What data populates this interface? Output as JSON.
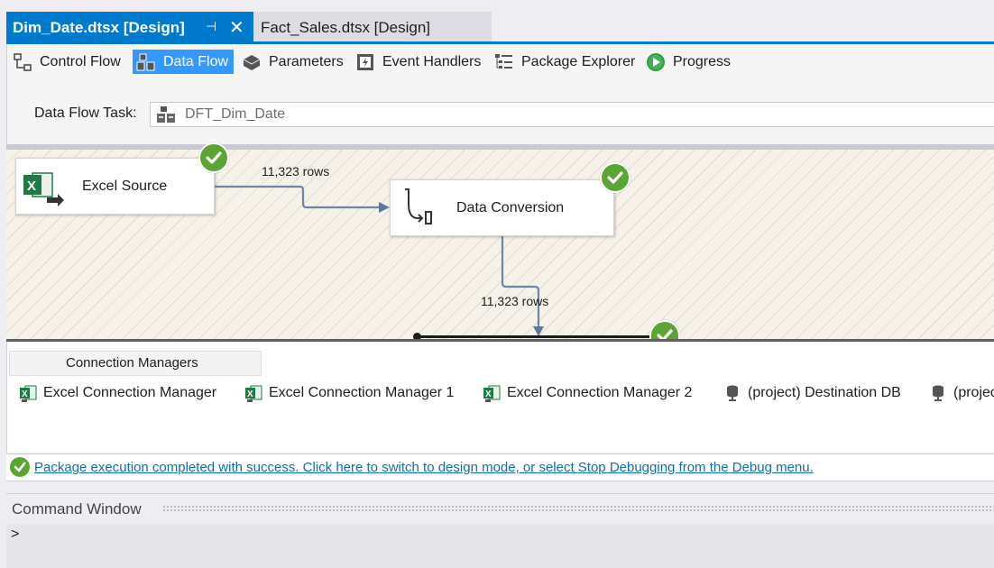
{
  "tabs": [
    {
      "label": "Dim_Date.dtsx [Design]",
      "active": true,
      "pin_icon": "pin-icon",
      "close_icon": "close-icon"
    },
    {
      "label": "Fact_Sales.dtsx [Design]",
      "active": false
    }
  ],
  "designer_tabs": [
    {
      "label": "Control Flow",
      "icon": "control-flow-icon",
      "selected": false
    },
    {
      "label": "Data Flow",
      "icon": "data-flow-icon",
      "selected": true
    },
    {
      "label": "Parameters",
      "icon": "parameters-icon",
      "selected": false
    },
    {
      "label": "Event Handlers",
      "icon": "event-handlers-icon",
      "selected": false
    },
    {
      "label": "Package Explorer",
      "icon": "package-explorer-icon",
      "selected": false
    },
    {
      "label": "Progress",
      "icon": "progress-icon",
      "selected": false
    }
  ],
  "data_flow_task": {
    "label": "Data Flow Task:",
    "value": "DFT_Dim_Date"
  },
  "canvas": {
    "components": [
      {
        "label": "Excel Source",
        "icon": "excel-source-icon",
        "status": "success"
      },
      {
        "label": "Data Conversion",
        "icon": "data-conversion-icon",
        "status": "success"
      }
    ],
    "paths": [
      {
        "rows_label": "11,323 rows"
      },
      {
        "rows_label": "11,323 rows"
      }
    ]
  },
  "connection_managers": {
    "header": "Connection Managers",
    "items": [
      {
        "label": "Excel Connection Manager",
        "icon": "excel-connection-icon"
      },
      {
        "label": "Excel Connection Manager 1",
        "icon": "excel-connection-icon"
      },
      {
        "label": "Excel Connection Manager 2",
        "icon": "excel-connection-icon"
      },
      {
        "label": "(project) Destination DB",
        "icon": "database-connection-icon"
      },
      {
        "label": "(projec",
        "icon": "database-connection-icon"
      }
    ]
  },
  "status_bar": {
    "message": "Package execution completed with success. Click here to switch to design mode, or select Stop Debugging from the Debug menu."
  },
  "command_window": {
    "title": "Command Window",
    "prompt": ">"
  },
  "colors": {
    "accent": "#007acc",
    "success": "#5aa534",
    "link": "#0e6db5",
    "selected_tab": "#3399ff"
  }
}
